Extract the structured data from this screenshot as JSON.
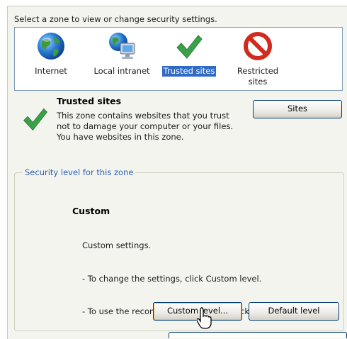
{
  "prompt": "Select a zone to view or change security settings.",
  "zones": [
    {
      "label": "Internet",
      "icon": "globe-icon",
      "selected": false
    },
    {
      "label": "Local intranet",
      "icon": "intranet-computer-icon",
      "selected": false
    },
    {
      "label": "Trusted sites",
      "icon": "checkmark-icon",
      "selected": true
    },
    {
      "label": "Restricted\nsites",
      "icon": "restricted-icon",
      "selected": false
    }
  ],
  "selected_zone": {
    "title": "Trusted sites",
    "description": "This zone contains websites that you trust not to damage your computer or your files.",
    "status": "You have websites in this zone.",
    "icon": "checkmark-icon"
  },
  "sites_button": "Sites",
  "security_level": {
    "legend": "Security level for this zone",
    "title": "Custom",
    "lines": [
      "Custom settings.",
      "- To change the settings, click Custom level.",
      "- To use the recommended settings, click Default level."
    ]
  },
  "buttons": {
    "custom_level": "Custom level...",
    "default_level": "Default level"
  },
  "colors": {
    "selection": "#316ac5",
    "legend_text": "#2a5fb8",
    "button_border": "#003c74",
    "check_green": "#3aa14a",
    "restricted_red": "#d22a1e"
  }
}
